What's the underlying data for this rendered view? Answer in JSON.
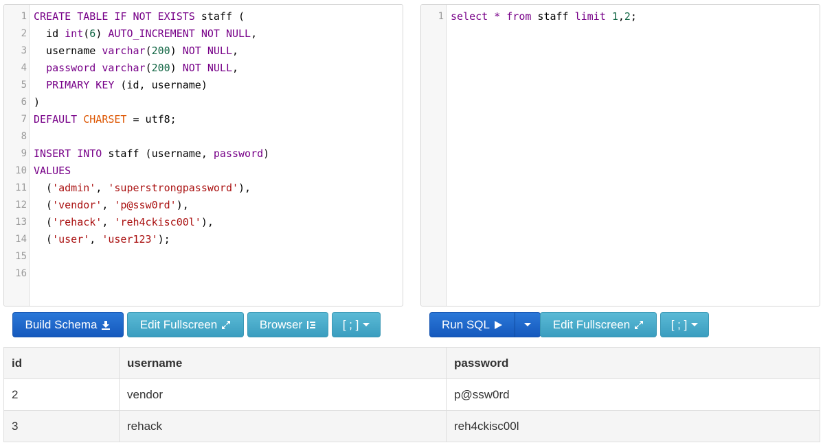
{
  "schema_editor": {
    "lines": [
      {
        "n": "1",
        "tokens": [
          {
            "t": "CREATE TABLE IF NOT EXISTS",
            "c": "kw"
          },
          {
            "t": " staff (",
            "c": ""
          }
        ]
      },
      {
        "n": "2",
        "tokens": [
          {
            "t": "  id ",
            "c": ""
          },
          {
            "t": "int",
            "c": "kw"
          },
          {
            "t": "(",
            "c": ""
          },
          {
            "t": "6",
            "c": "num"
          },
          {
            "t": ") ",
            "c": ""
          },
          {
            "t": "AUTO_INCREMENT NOT NULL",
            "c": "kw"
          },
          {
            "t": ",",
            "c": ""
          }
        ]
      },
      {
        "n": "3",
        "tokens": [
          {
            "t": "  username ",
            "c": ""
          },
          {
            "t": "varchar",
            "c": "kw"
          },
          {
            "t": "(",
            "c": ""
          },
          {
            "t": "200",
            "c": "num"
          },
          {
            "t": ") ",
            "c": ""
          },
          {
            "t": "NOT NULL",
            "c": "kw"
          },
          {
            "t": ",",
            "c": ""
          }
        ]
      },
      {
        "n": "4",
        "tokens": [
          {
            "t": "  ",
            "c": ""
          },
          {
            "t": "password",
            "c": "kw"
          },
          {
            "t": " ",
            "c": ""
          },
          {
            "t": "varchar",
            "c": "kw"
          },
          {
            "t": "(",
            "c": ""
          },
          {
            "t": "200",
            "c": "num"
          },
          {
            "t": ") ",
            "c": ""
          },
          {
            "t": "NOT NULL",
            "c": "kw"
          },
          {
            "t": ",",
            "c": ""
          }
        ]
      },
      {
        "n": "5",
        "tokens": [
          {
            "t": "  ",
            "c": ""
          },
          {
            "t": "PRIMARY KEY",
            "c": "kw"
          },
          {
            "t": " (id, username)",
            "c": ""
          }
        ]
      },
      {
        "n": "6",
        "tokens": [
          {
            "t": ")",
            "c": ""
          }
        ]
      },
      {
        "n": "7",
        "tokens": [
          {
            "t": "DEFAULT",
            "c": "kw"
          },
          {
            "t": " ",
            "c": ""
          },
          {
            "t": "CHARSET",
            "c": "bi"
          },
          {
            "t": " = utf8;",
            "c": ""
          }
        ]
      },
      {
        "n": "8",
        "tokens": []
      },
      {
        "n": "9",
        "tokens": [
          {
            "t": "INSERT INTO",
            "c": "kw"
          },
          {
            "t": " staff (username, ",
            "c": ""
          },
          {
            "t": "password",
            "c": "kw"
          },
          {
            "t": ")",
            "c": ""
          }
        ]
      },
      {
        "n": "10",
        "tokens": [
          {
            "t": "VALUES",
            "c": "kw"
          }
        ]
      },
      {
        "n": "11",
        "tokens": [
          {
            "t": "  (",
            "c": ""
          },
          {
            "t": "'admin'",
            "c": "str"
          },
          {
            "t": ", ",
            "c": ""
          },
          {
            "t": "'superstrongpassword'",
            "c": "str"
          },
          {
            "t": "),",
            "c": ""
          }
        ]
      },
      {
        "n": "12",
        "tokens": [
          {
            "t": "  (",
            "c": ""
          },
          {
            "t": "'vendor'",
            "c": "str"
          },
          {
            "t": ", ",
            "c": ""
          },
          {
            "t": "'p@ssw0rd'",
            "c": "str"
          },
          {
            "t": "),",
            "c": ""
          }
        ]
      },
      {
        "n": "13",
        "tokens": [
          {
            "t": "  (",
            "c": ""
          },
          {
            "t": "'rehack'",
            "c": "str"
          },
          {
            "t": ", ",
            "c": ""
          },
          {
            "t": "'reh4ckisc00l'",
            "c": "str"
          },
          {
            "t": "),",
            "c": ""
          }
        ]
      },
      {
        "n": "14",
        "tokens": [
          {
            "t": "  (",
            "c": ""
          },
          {
            "t": "'user'",
            "c": "str"
          },
          {
            "t": ", ",
            "c": ""
          },
          {
            "t": "'user123'",
            "c": "str"
          },
          {
            "t": ");",
            "c": ""
          }
        ]
      },
      {
        "n": "15",
        "tokens": []
      },
      {
        "n": "16",
        "tokens": []
      }
    ]
  },
  "query_editor": {
    "lines": [
      {
        "n": "1",
        "tokens": [
          {
            "t": "select",
            "c": "kw"
          },
          {
            "t": " ",
            "c": ""
          },
          {
            "t": "*",
            "c": "kw"
          },
          {
            "t": " ",
            "c": ""
          },
          {
            "t": "from",
            "c": "kw"
          },
          {
            "t": " staff ",
            "c": ""
          },
          {
            "t": "limit",
            "c": "kw"
          },
          {
            "t": " ",
            "c": ""
          },
          {
            "t": "1",
            "c": "num"
          },
          {
            "t": ",",
            "c": ""
          },
          {
            "t": "2",
            "c": "num"
          },
          {
            "t": ";",
            "c": ""
          }
        ]
      }
    ]
  },
  "schema_toolbar": {
    "build_schema": "Build Schema",
    "edit_fullscreen": "Edit Fullscreen",
    "browser": "Browser",
    "delimiter": "[ ; ]"
  },
  "query_toolbar": {
    "run_sql": "Run SQL",
    "edit_fullscreen": "Edit Fullscreen",
    "delimiter": "[ ; ]"
  },
  "icons": {
    "build": "download-icon",
    "fullscreen": "expand-icon",
    "browser": "tree-icon",
    "run": "play-icon",
    "dropdown": "caret-down-icon"
  },
  "colors": {
    "primary": "#1a63c9",
    "info": "#40a7c8",
    "keyword": "#770088",
    "string": "#aa1111",
    "number": "#116644",
    "builtin": "#dd5500"
  },
  "results": {
    "columns": [
      "id",
      "username",
      "password"
    ],
    "rows": [
      [
        "2",
        "vendor",
        "p@ssw0rd"
      ],
      [
        "3",
        "rehack",
        "reh4ckisc00l"
      ]
    ]
  }
}
